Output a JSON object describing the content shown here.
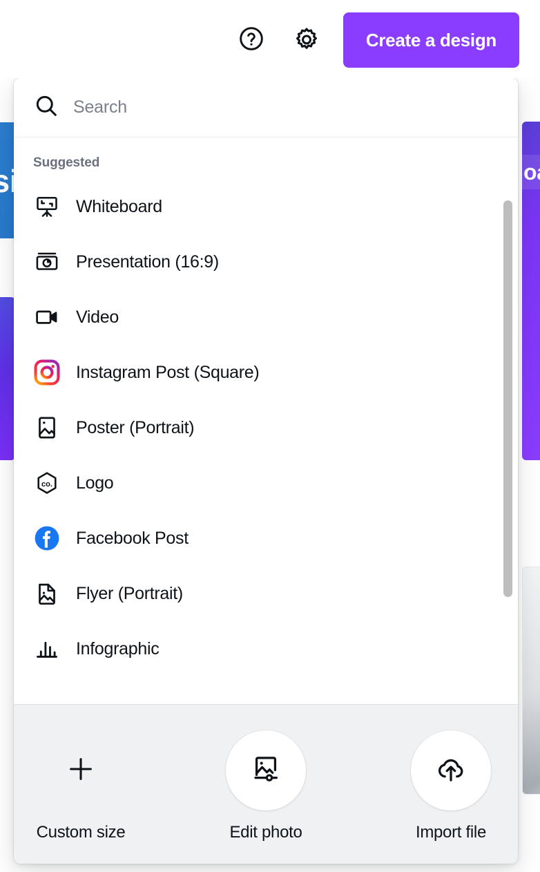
{
  "topbar": {
    "help_icon": "help-circle-icon",
    "settings_icon": "gear-icon",
    "create_button_label": "Create a design"
  },
  "background": {
    "card_blue_left_text": "si",
    "card_purple_right_text": "oard",
    "colors": {
      "blue": "#2677cb",
      "purple": "#8b3dff",
      "grey": "#dfe1e5"
    }
  },
  "dropdown": {
    "search": {
      "placeholder": "Search",
      "value": "",
      "icon": "search-icon"
    },
    "section_label": "Suggested",
    "items": [
      {
        "label": "Whiteboard",
        "icon": "whiteboard-icon"
      },
      {
        "label": "Presentation (16:9)",
        "icon": "presentation-icon"
      },
      {
        "label": "Video",
        "icon": "video-camera-icon"
      },
      {
        "label": "Instagram Post (Square)",
        "icon": "instagram-icon"
      },
      {
        "label": "Poster (Portrait)",
        "icon": "poster-icon"
      },
      {
        "label": "Logo",
        "icon": "logo-hexagon-icon"
      },
      {
        "label": "Facebook Post",
        "icon": "facebook-icon"
      },
      {
        "label": "Flyer (Portrait)",
        "icon": "flyer-icon"
      },
      {
        "label": "Infographic",
        "icon": "infographic-bars-icon"
      }
    ],
    "footer": {
      "actions": [
        {
          "label": "Custom size",
          "icon": "plus-icon"
        },
        {
          "label": "Edit photo",
          "icon": "image-edit-icon"
        },
        {
          "label": "Import file",
          "icon": "cloud-upload-icon"
        }
      ]
    },
    "scrollbar": {
      "visible": true
    }
  }
}
